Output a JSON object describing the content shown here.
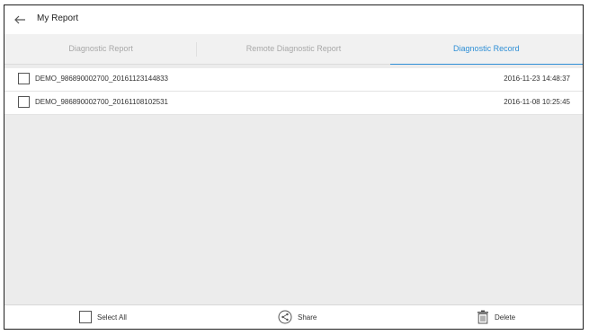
{
  "header": {
    "back_icon": "arrow-left-icon",
    "title": "My Report"
  },
  "tabs": [
    {
      "label": "Diagnostic Report",
      "active": false
    },
    {
      "label": "Remote Diagnostic Report",
      "active": false
    },
    {
      "label": "Diagnostic Record",
      "active": true
    }
  ],
  "records": [
    {
      "name": "DEMO_986890002700_20161123144833",
      "timestamp": "2016-11-23 14:48:37",
      "checked": false
    },
    {
      "name": "DEMO_986890002700_20161108102531",
      "timestamp": "2016-11-08 10:25:45",
      "checked": false
    }
  ],
  "footer": {
    "select_all_label": "Select All",
    "share_label": "Share",
    "share_icon": "share-icon",
    "delete_label": "Delete",
    "delete_icon": "trash-icon"
  },
  "colors": {
    "accent": "#2f8fd6",
    "tab_inactive": "#a8a8a8",
    "background": "#ececec"
  }
}
